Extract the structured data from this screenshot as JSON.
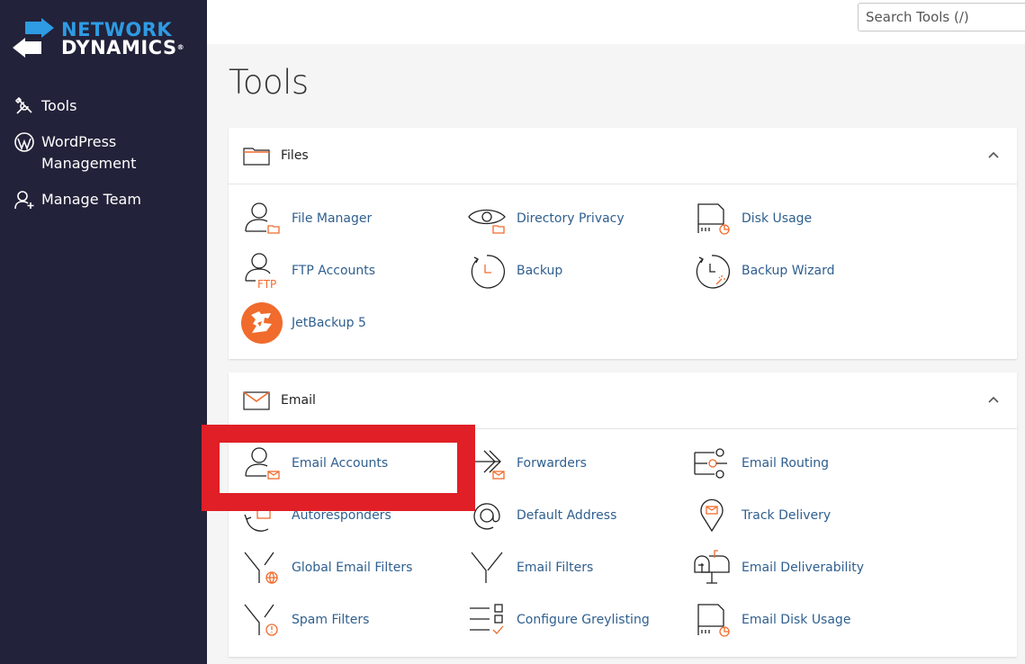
{
  "brand": {
    "line1": "NETWORK",
    "line2": "DYNAMICS",
    "registered": "®",
    "accent_color": "#2e9be3"
  },
  "sidebar": {
    "items": [
      {
        "label": "Tools",
        "icon": "tools-icon"
      },
      {
        "label": "WordPress Management",
        "icon": "wordpress-icon"
      },
      {
        "label": "Manage Team",
        "icon": "manage-team-icon"
      }
    ]
  },
  "search": {
    "placeholder": "Search Tools (/)"
  },
  "page": {
    "title": "Tools"
  },
  "sections": {
    "files": {
      "title": "Files",
      "tools": [
        {
          "label": "File Manager",
          "icon": "file-manager-icon"
        },
        {
          "label": "Directory Privacy",
          "icon": "directory-privacy-icon"
        },
        {
          "label": "Disk Usage",
          "icon": "disk-usage-icon"
        },
        {
          "label": "FTP Accounts",
          "icon": "ftp-accounts-icon"
        },
        {
          "label": "Backup",
          "icon": "backup-icon"
        },
        {
          "label": "Backup Wizard",
          "icon": "backup-wizard-icon"
        },
        {
          "label": "JetBackup 5",
          "icon": "jetbackup-icon"
        }
      ]
    },
    "email": {
      "title": "Email",
      "tools": [
        {
          "label": "Email Accounts",
          "icon": "email-accounts-icon"
        },
        {
          "label": "Forwarders",
          "icon": "forwarders-icon"
        },
        {
          "label": "Email Routing",
          "icon": "email-routing-icon"
        },
        {
          "label": "Autoresponders",
          "icon": "autoresponders-icon"
        },
        {
          "label": "Default Address",
          "icon": "default-address-icon"
        },
        {
          "label": "Track Delivery",
          "icon": "track-delivery-icon"
        },
        {
          "label": "Global Email Filters",
          "icon": "global-email-filters-icon"
        },
        {
          "label": "Email Filters",
          "icon": "email-filters-icon"
        },
        {
          "label": "Email Deliverability",
          "icon": "email-deliverability-icon"
        },
        {
          "label": "Spam Filters",
          "icon": "spam-filters-icon"
        },
        {
          "label": "Configure Greylisting",
          "icon": "configure-greylisting-icon"
        },
        {
          "label": "Email Disk Usage",
          "icon": "email-disk-usage-icon"
        }
      ]
    }
  },
  "colors": {
    "sidebar_bg": "#22223a",
    "link": "#2f5f8f",
    "icon_accent": "#f06b2c",
    "highlight": "#e01f26"
  }
}
